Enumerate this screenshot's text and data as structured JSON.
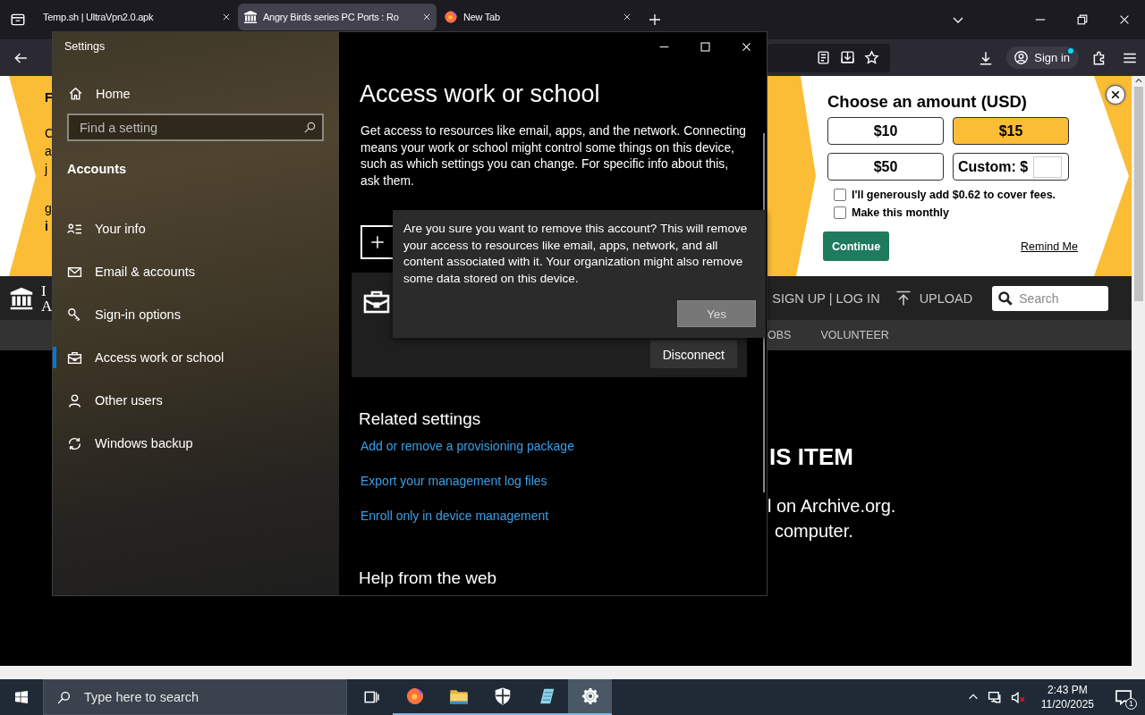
{
  "browser": {
    "tabs": [
      {
        "title": "Temp.sh | UltraVpn2.0.apk",
        "selected": false
      },
      {
        "title": "Angry Birds series PC Ports : Ro",
        "selected": true
      },
      {
        "title": "New Tab",
        "selected": false
      }
    ],
    "sign_in": "Sign in",
    "banner": {
      "fragments": [
        {
          "text": "F",
          "bold": true
        },
        {
          "text": "C",
          "bold": false
        },
        {
          "text": "a",
          "bold": false
        },
        {
          "text": "j",
          "bold": false
        },
        {
          "text": "g",
          "bold": false
        },
        {
          "text": "i",
          "bold": true
        }
      ],
      "donation": {
        "title": "Choose an amount (USD)",
        "amounts": [
          {
            "label": "$10",
            "selected": false
          },
          {
            "label": "$15",
            "selected": true
          },
          {
            "label": "$50",
            "selected": false
          }
        ],
        "custom_label": "Custom: $",
        "options": [
          {
            "label": "I'll generously add $0.62 to cover fees.",
            "checked": false
          },
          {
            "label": "Make this monthly",
            "checked": false
          }
        ],
        "continue": "Continue",
        "remind": "Remind Me"
      }
    },
    "site_nav": {
      "logo_fragments": [
        "I",
        "A"
      ],
      "sign_up": "SIGN UP | LOG IN",
      "upload": "UPLOAD",
      "search_placeholder": "Search",
      "links": [
        "OBS",
        "VOLUNTEER"
      ]
    },
    "page": {
      "heading": "IS ITEM",
      "lines": [
        "l on Archive.org.",
        "computer."
      ]
    }
  },
  "settings": {
    "title": "Settings",
    "home": "Home",
    "search_placeholder": "Find a setting",
    "section": "Accounts",
    "nav": [
      {
        "label": "Your info",
        "selected": false
      },
      {
        "label": "Email & accounts",
        "selected": false
      },
      {
        "label": "Sign-in options",
        "selected": false
      },
      {
        "label": "Access work or school",
        "selected": true
      },
      {
        "label": "Other users",
        "selected": false
      },
      {
        "label": "Windows backup",
        "selected": false
      }
    ],
    "heading": "Access work or school",
    "description": "Get access to resources like email, apps, and the network. Connecting means your work or school might control some things on this device, such as which settings you can change. For specific info about this, ask them.",
    "disconnect": "Disconnect",
    "related_title": "Related settings",
    "related_links": [
      "Add or remove a provisioning package",
      "Export your management log files",
      "Enroll only in device management"
    ],
    "help_title": "Help from the web",
    "dialog": {
      "message": "Are you sure you want to remove this account? This will remove your access to resources like email, apps, network, and all content associated with it. Your organization might also remove some data stored on this device.",
      "confirm": "Yes"
    }
  },
  "taskbar": {
    "search_placeholder": "Type here to search",
    "apps": [
      {
        "running": false,
        "selected": false
      },
      {
        "running": true,
        "selected": false
      },
      {
        "running": true,
        "selected": false
      },
      {
        "running": true,
        "selected": false
      },
      {
        "running": true,
        "selected": false
      },
      {
        "running": true,
        "selected": true
      }
    ],
    "time": "2:43 PM",
    "date": "11/20/2025",
    "notifications": "1"
  }
}
